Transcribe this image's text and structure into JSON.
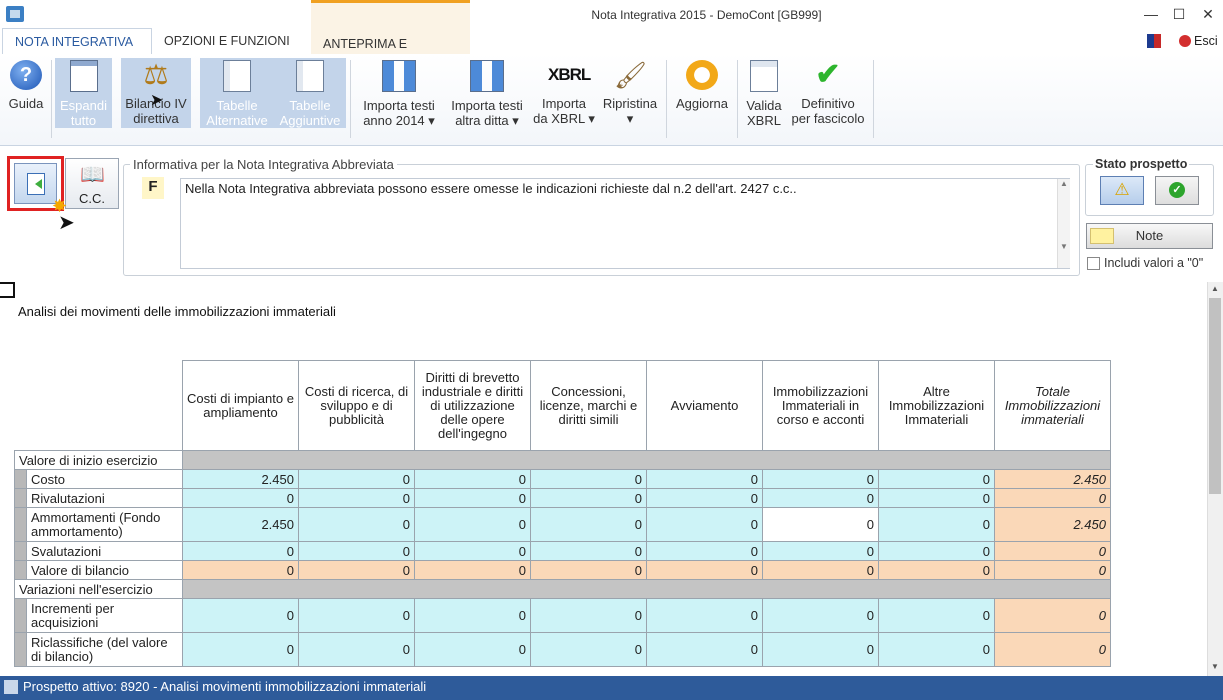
{
  "window": {
    "title": "Nota Integrativa 2015 - DemoCont [GB999]"
  },
  "tabs": [
    "NOTA INTEGRATIVA",
    "OPZIONI E FUNZIONI",
    "ANTEPRIMA E STAMPA"
  ],
  "esci_label": "Esci",
  "ribbon": {
    "guida": "Guida",
    "espandi": [
      "Espandi",
      "tutto"
    ],
    "bilancio": [
      "Bilancio IV",
      "direttiva"
    ],
    "tabelle_alt": [
      "Tabelle",
      "Alternative"
    ],
    "tabelle_agg": [
      "Tabelle",
      "Aggiuntive"
    ],
    "importa_2014": [
      "Importa testi",
      "anno 2014 ▾"
    ],
    "importa_ditta": [
      "Importa testi",
      "altra ditta ▾"
    ],
    "importa_xbrl": [
      "Importa",
      "da XBRL ▾"
    ],
    "xbrl_icon_text": "XBRL",
    "ripristina": [
      "Ripristina",
      "▾"
    ],
    "aggiorna": "Aggiorna",
    "valida": [
      "Valida",
      "XBRL"
    ],
    "definitivo": [
      "Definitivo",
      "per fascicolo"
    ]
  },
  "cc_label": "C.C.",
  "info": {
    "legend": "Informativa per la Nota Integrativa Abbreviata",
    "letter": "F",
    "text": "Nella Nota Integrativa abbreviata possono essere omesse le indicazioni richieste dal n.2 dell'art. 2427 c.c.."
  },
  "stato": {
    "label": "Stato prospetto",
    "note": "Note",
    "includi": "Includi valori a \"0\""
  },
  "section_title": "Analisi dei movimenti delle immobilizzazioni immateriali",
  "table": {
    "headers": [
      "Costi di impianto e ampliamento",
      "Costi di ricerca, di sviluppo e di pubblicità",
      "Diritti di brevetto industriale e diritti di utilizzazione delle opere dell'ingegno",
      "Concessioni, licenze, marchi e diritti simili",
      "Avviamento",
      "Immobilizzazioni Immateriali in corso e acconti",
      "Altre Immobilizzazioni Immateriali",
      "Totale Immobilizzazioni immateriali"
    ],
    "sections": [
      {
        "title": "Valore di inizio esercizio",
        "rows": [
          {
            "label": "Costo",
            "values": [
              "2.450",
              "0",
              "0",
              "0",
              "0",
              "0",
              "0",
              "2.450"
            ]
          },
          {
            "label": "Rivalutazioni",
            "values": [
              "0",
              "0",
              "0",
              "0",
              "0",
              "0",
              "0",
              "0"
            ]
          },
          {
            "label": "Ammortamenti (Fondo ammortamento)",
            "values": [
              "2.450",
              "0",
              "0",
              "0",
              "0",
              "0",
              "0",
              "2.450"
            ]
          },
          {
            "label": "Svalutazioni",
            "values": [
              "0",
              "0",
              "0",
              "0",
              "0",
              "0",
              "0",
              "0"
            ]
          },
          {
            "label": "Valore di bilancio",
            "values": [
              "0",
              "0",
              "0",
              "0",
              "0",
              "0",
              "0",
              "0"
            ]
          }
        ]
      },
      {
        "title": "Variazioni nell'esercizio",
        "rows": [
          {
            "label": "Incrementi per acquisizioni",
            "values": [
              "0",
              "0",
              "0",
              "0",
              "0",
              "0",
              "0",
              "0"
            ]
          },
          {
            "label": "Riclassifiche (del valore di bilancio)",
            "values": [
              "0",
              "0",
              "0",
              "0",
              "0",
              "0",
              "0",
              "0"
            ]
          }
        ]
      }
    ]
  },
  "statusbar": "Prospetto attivo: 8920 - Analisi movimenti immobilizzazioni immateriali"
}
